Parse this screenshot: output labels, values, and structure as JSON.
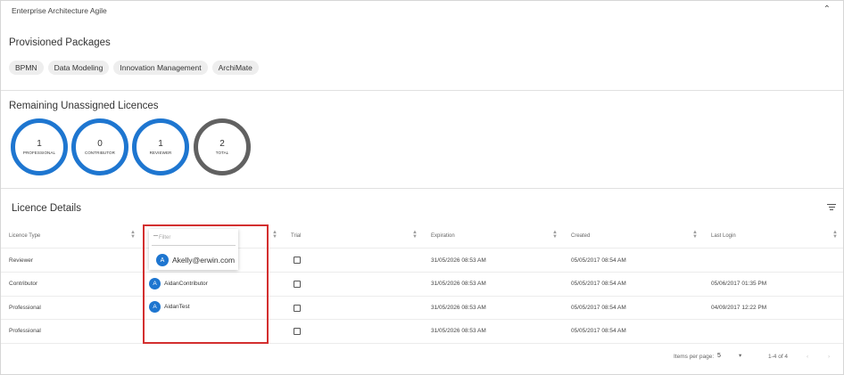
{
  "header": {
    "title": "Enterprise Architecture Agile",
    "collapse_icon": "chevron-up-icon"
  },
  "packages": {
    "title": "Provisioned Packages",
    "chips": [
      "BPMN",
      "Data Modeling",
      "Innovation Management",
      "ArchiMate"
    ]
  },
  "licences": {
    "title": "Remaining Unassigned Licences",
    "circles": [
      {
        "count": "1",
        "label": "PROFESSIONAL"
      },
      {
        "count": "0",
        "label": "CONTRIBUTOR"
      },
      {
        "count": "1",
        "label": "REVIEWER"
      },
      {
        "count": "2",
        "label": "TOTAL"
      }
    ],
    "accent_color": "#1e76d0",
    "total_color": "#616161"
  },
  "details": {
    "title": "Licence Details",
    "columns": [
      "Licence Type",
      "Trial",
      "Expiration",
      "Created",
      "Last Login"
    ],
    "rows": [
      {
        "type": "Reviewer",
        "expiration": "31/05/2026 08:53 AM",
        "created": "05/05/2017 08:54 AM",
        "last_login": ""
      },
      {
        "type": "Contributor",
        "expiration": "31/05/2026 08:53 AM",
        "created": "05/05/2017 08:54 AM",
        "last_login": "05/06/2017 01:35 PM"
      },
      {
        "type": "Professional",
        "expiration": "31/05/2026 08:53 AM",
        "created": "05/05/2017 08:54 AM",
        "last_login": "04/09/2017 12:22 PM"
      },
      {
        "type": "Professional",
        "expiration": "31/05/2026 08:53 AM",
        "created": "05/05/2017 08:54 AM",
        "last_login": ""
      }
    ],
    "filter_placeholder": "Filter",
    "dropdown_user": {
      "initial": "A",
      "email": "Akelly@erwin.com"
    },
    "users": [
      {
        "initial": "A",
        "name": "AidanContributor"
      },
      {
        "initial": "A",
        "name": "AidanTest"
      }
    ],
    "paginator": {
      "label": "Items per page:",
      "value": "5",
      "range": "1-4 of 4"
    },
    "highlight_color": "#d32f2f"
  }
}
